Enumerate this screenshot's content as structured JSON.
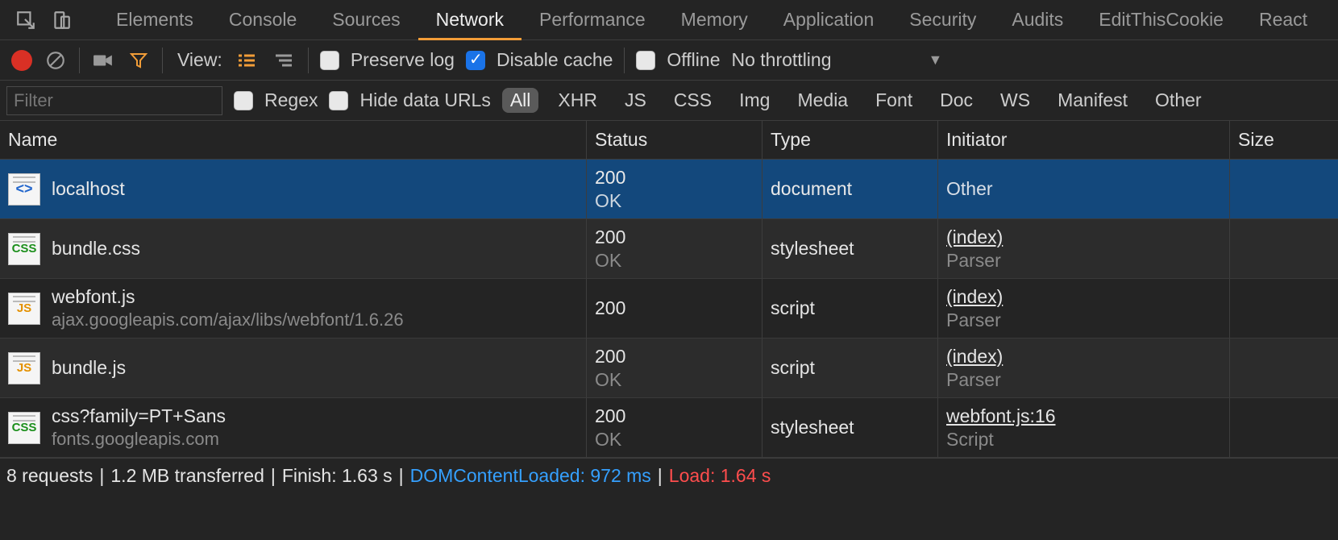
{
  "tabs": [
    "Elements",
    "Console",
    "Sources",
    "Network",
    "Performance",
    "Memory",
    "Application",
    "Security",
    "Audits",
    "EditThisCookie",
    "React"
  ],
  "active_tab": "Network",
  "toolbar": {
    "view_label": "View:",
    "preserve_log": "Preserve log",
    "disable_cache": "Disable cache",
    "disable_cache_checked": true,
    "offline": "Offline",
    "throttling": "No throttling"
  },
  "filterbar": {
    "placeholder": "Filter",
    "regex": "Regex",
    "hide_data_urls": "Hide data URLs",
    "types": [
      "All",
      "XHR",
      "JS",
      "CSS",
      "Img",
      "Media",
      "Font",
      "Doc",
      "WS",
      "Manifest",
      "Other"
    ],
    "active_type": "All"
  },
  "columns": [
    "Name",
    "Status",
    "Type",
    "Initiator",
    "Size"
  ],
  "rows": [
    {
      "icon": "doc",
      "name": "localhost",
      "sub": "",
      "status_code": "200",
      "status_text": "OK",
      "type": "document",
      "initiator": "Other",
      "initiator_link": false,
      "initiator_sub": "",
      "selected": true
    },
    {
      "icon": "css",
      "name": "bundle.css",
      "sub": "",
      "status_code": "200",
      "status_text": "OK",
      "type": "stylesheet",
      "initiator": "(index)",
      "initiator_link": true,
      "initiator_sub": "Parser",
      "selected": false
    },
    {
      "icon": "js",
      "name": "webfont.js",
      "sub": "ajax.googleapis.com/ajax/libs/webfont/1.6.26",
      "status_code": "200",
      "status_text": "",
      "type": "script",
      "initiator": "(index)",
      "initiator_link": true,
      "initiator_sub": "Parser",
      "selected": false
    },
    {
      "icon": "js",
      "name": "bundle.js",
      "sub": "",
      "status_code": "200",
      "status_text": "OK",
      "type": "script",
      "initiator": "(index)",
      "initiator_link": true,
      "initiator_sub": "Parser",
      "selected": false
    },
    {
      "icon": "css",
      "name": "css?family=PT+Sans",
      "sub": "fonts.googleapis.com",
      "status_code": "200",
      "status_text": "OK",
      "type": "stylesheet",
      "initiator": "webfont.js:16",
      "initiator_link": true,
      "initiator_sub": "Script",
      "selected": false
    }
  ],
  "status": {
    "requests": "8 requests",
    "transferred": "1.2 MB transferred",
    "finish": "Finish: 1.63 s",
    "dcl": "DOMContentLoaded: 972 ms",
    "load": "Load: 1.64 s"
  }
}
